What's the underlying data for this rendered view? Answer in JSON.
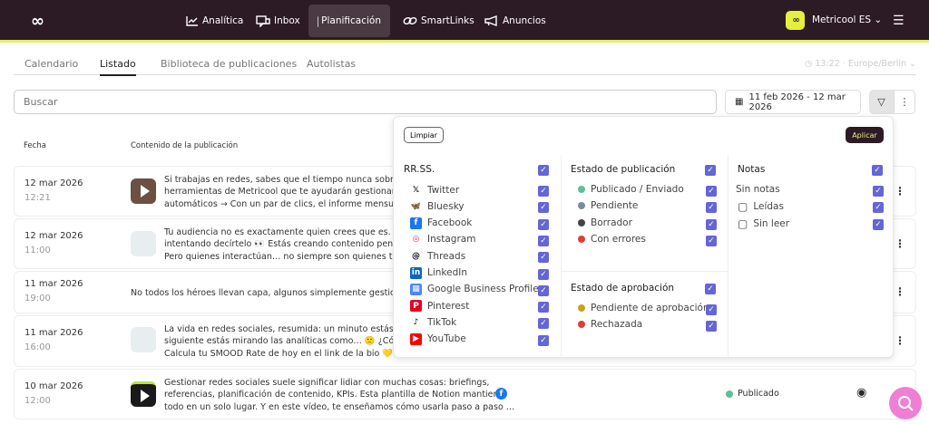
{
  "nav": {
    "items": [
      {
        "label": "Analítica",
        "icon": "chart-line-icon"
      },
      {
        "label": "Inbox",
        "icon": "chat-icon"
      },
      {
        "label": "Planificación",
        "icon": "calendar-icon",
        "active": true
      },
      {
        "label": "SmartLinks",
        "icon": "link-icon"
      },
      {
        "label": "Anuncios",
        "icon": "megaphone-icon"
      }
    ],
    "account": "Metricool ES",
    "logo": "∞"
  },
  "tabs": [
    {
      "label": "Calendario"
    },
    {
      "label": "Listado",
      "active": true
    },
    {
      "label": "Biblioteca de publicaciones"
    },
    {
      "label": "Autolistas"
    }
  ],
  "timezone": "13:22 · Europe/Berlin",
  "search": {
    "placeholder": "Buscar"
  },
  "date_range": "11 feb 2026 - 12 mar 2026",
  "headers": {
    "date": "Fecha",
    "content": "Contenido de la publicación"
  },
  "rows": [
    {
      "date": "12 mar 2026",
      "time": "12:21",
      "lines": [
        "Si trabajas en redes, sabes que el tiempo nunca sobra.  Por es",
        "herramientas de Metricool que te ayudarán gestionando las re",
        "automáticos → Con un par de clics, el informe mensual está lis"
      ]
    },
    {
      "date": "12 mar 2026",
      "time": "11:00",
      "lines": [
        "Tu audiencia no es exactamente quien crees que es. Y tus ana",
        "intentando decírtelo 👀  Estás creando contenido pensando er",
        "Pero quienes interactúan… no siempre son quienes te contrata"
      ]
    },
    {
      "date": "11 mar 2026",
      "time": "19:00",
      "lines": [
        "No todos los héroes llevan capa, algunos simplemente gestionan seis c"
      ]
    },
    {
      "date": "11 mar 2026",
      "time": "16:00",
      "lines": [
        "La vida en redes sociales, resumida: un minuto estás arriba co",
        "siguiente estás mirando las analíticas como… 🙂 ¿Cómo te sie",
        "Calcula tu SMOOD Rate de hoy en el link de la bio 💛"
      ]
    },
    {
      "date": "10 mar 2026",
      "time": "12:00",
      "lines": [
        "Gestionar redes sociales suele significar lidiar con muchas cosas: briefings,",
        "referencias, planificación de contenido, KPIs. Esta plantilla de Notion mantiene",
        "todo en un solo lugar. Y en este vídeo, te enseñamos cómo usarla paso a paso …"
      ],
      "network": "facebook",
      "status": "Publicado",
      "status_color": "#5fbf98"
    }
  ],
  "filter": {
    "clear": "Limpiar",
    "apply": "Aplicar",
    "networks": {
      "title": "RR.SS.",
      "items": [
        {
          "label": "Twitter",
          "icon": "x-icon",
          "color": "#000000"
        },
        {
          "label": "Bluesky",
          "icon": "bluesky-icon",
          "color": "#1185fe"
        },
        {
          "label": "Facebook",
          "icon": "facebook-icon",
          "color": "#1877f2"
        },
        {
          "label": "Instagram",
          "icon": "instagram-icon",
          "color": "#e1306c"
        },
        {
          "label": "Threads",
          "icon": "threads-icon",
          "color": "#000000"
        },
        {
          "label": "LinkedIn",
          "icon": "linkedin-icon",
          "color": "#0a66c2"
        },
        {
          "label": "Google Business Profile",
          "icon": "google-business-icon",
          "color": "#4a8af4"
        },
        {
          "label": "Pinterest",
          "icon": "pinterest-icon",
          "color": "#e60023"
        },
        {
          "label": "TikTok",
          "icon": "tiktok-icon",
          "color": "#000000"
        },
        {
          "label": "YouTube",
          "icon": "youtube-icon",
          "color": "#ff0000"
        }
      ]
    },
    "pub_status": {
      "title": "Estado de publicación",
      "items": [
        {
          "label": "Publicado / Enviado",
          "color": "#5fbf98"
        },
        {
          "label": "Pendiente",
          "color": "#7b8d99"
        },
        {
          "label": "Borrador",
          "color": "#444444"
        },
        {
          "label": "Con errores",
          "color": "#e03c3c"
        }
      ]
    },
    "approval": {
      "title": "Estado de aprobación",
      "items": [
        {
          "label": "Pendiente de aprobación",
          "color": "#c9a21a"
        },
        {
          "label": "Rechazada",
          "color": "#e03c3c"
        }
      ]
    },
    "notes": {
      "title": "Notas",
      "items": [
        {
          "label": "Sin notas"
        },
        {
          "label": "Leídas",
          "icon": "note-read-icon"
        },
        {
          "label": "Sin leer",
          "icon": "note-unread-icon"
        }
      ]
    }
  },
  "colors": {
    "topbar": "#2c1b24",
    "accent": "#e6ef6b",
    "checkbox": "#6366d6",
    "fab": "#ee7fd4"
  }
}
